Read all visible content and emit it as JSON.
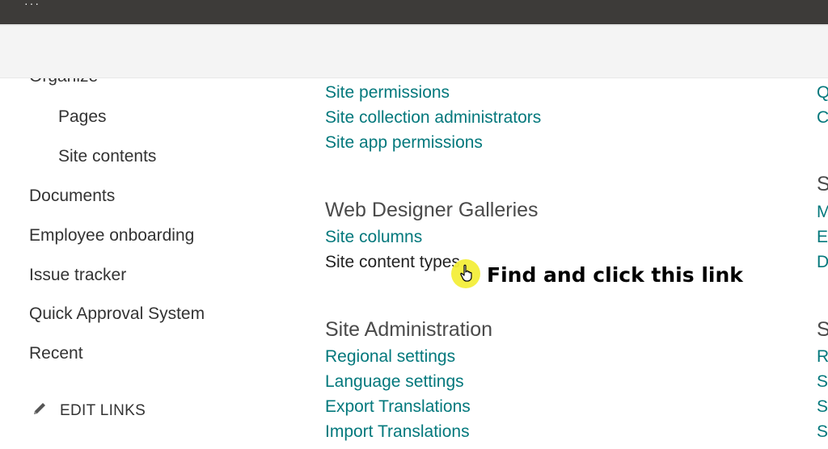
{
  "topbar": {
    "app_launcher_glyph": "···"
  },
  "nav": {
    "cut_item": "Organize",
    "items": [
      "Pages",
      "Site contents",
      "Documents",
      "Employee onboarding",
      "Issue tracker",
      "Quick Approval System",
      "Recent"
    ],
    "edit_links": "EDIT LINKS"
  },
  "main": {
    "users_permissions_links": [
      "Site permissions",
      "Site collection administrators",
      "Site app permissions"
    ],
    "web_designer_heading": "Web Designer Galleries",
    "site_columns": "Site columns",
    "site_content_types": "Site content types",
    "site_admin_heading": "Site Administration",
    "site_admin_links": [
      "Regional settings",
      "Language settings",
      "Export Translations",
      "Import Translations"
    ]
  },
  "right_column": {
    "row1": "Q",
    "row2": "C",
    "head1": "S",
    "row3": "M",
    "row4": "E",
    "row5": "D",
    "head2": "S",
    "row6": "R",
    "row7": "S",
    "row8": "S",
    "row9": "S"
  },
  "overlay": {
    "hint": "Find and click this link"
  },
  "colors": {
    "link": "#03787c",
    "topbar": "#3d3b39",
    "highlight": "#f3ee3a"
  },
  "icons": [
    "pencil-icon",
    "hand-cursor-icon"
  ]
}
